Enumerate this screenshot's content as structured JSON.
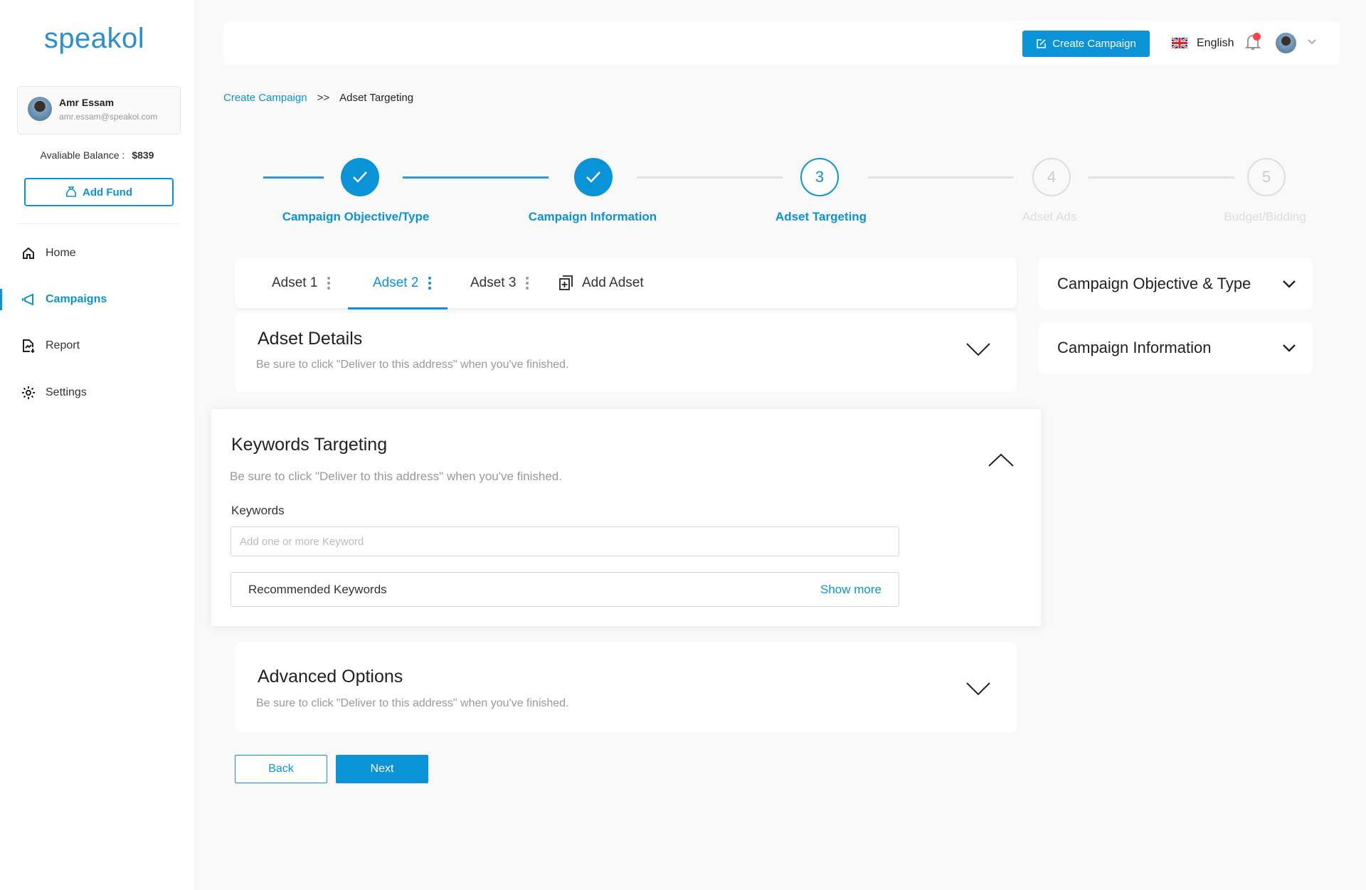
{
  "sidebar": {
    "logo": "speakol",
    "user": {
      "name": "Amr Essam",
      "email": "amr.essam@speakol.com"
    },
    "balance_label": "Avaliable Balance :",
    "balance_value": "$839",
    "add_fund": "Add Fund",
    "nav": [
      {
        "label": "Home",
        "icon": "home-icon"
      },
      {
        "label": "Campaigns",
        "icon": "megaphone-icon",
        "active": true
      },
      {
        "label": "Report",
        "icon": "report-icon"
      },
      {
        "label": "Settings",
        "icon": "gear-icon"
      }
    ]
  },
  "topbar": {
    "create_campaign": "Create Campaign",
    "language": "English"
  },
  "breadcrumb": {
    "parent": "Create Campaign",
    "separator": ">>",
    "current": "Adset Targeting"
  },
  "stepper": [
    {
      "label": "Campaign Objective/Type",
      "status": "done"
    },
    {
      "label": "Campaign Information",
      "status": "done"
    },
    {
      "number": "3",
      "label": "Adset Targeting",
      "status": "current"
    },
    {
      "number": "4",
      "label": "Adset Ads",
      "status": "todo"
    },
    {
      "number": "5",
      "label": "Budget/Bidding",
      "status": "todo"
    }
  ],
  "tabs": {
    "items": [
      "Adset 1",
      "Adset 2",
      "Adset 3"
    ],
    "active": "Adset 2",
    "add": "Add Adset"
  },
  "sections": {
    "adset_details": {
      "title": "Adset Details",
      "subtitle": "Be sure to click \"Deliver to this address\" when you've finished."
    },
    "keywords": {
      "title": "Keywords Targeting",
      "subtitle": "Be sure to click \"Deliver to this address\" when you've finished.",
      "field_label": "Keywords",
      "placeholder": "Add one or more Keyword",
      "recommended": "Recommended Keywords",
      "show_more": "Show more"
    },
    "advanced": {
      "title": "Advanced Options",
      "subtitle": "Be sure to click \"Deliver to this address\" when you've finished."
    }
  },
  "actions": {
    "back": "Back",
    "next": "Next"
  },
  "right_panels": [
    "Campaign Objective & Type",
    "Campaign Information"
  ],
  "colors": {
    "accent": "#0b93d8",
    "notification": "#ff4444"
  }
}
